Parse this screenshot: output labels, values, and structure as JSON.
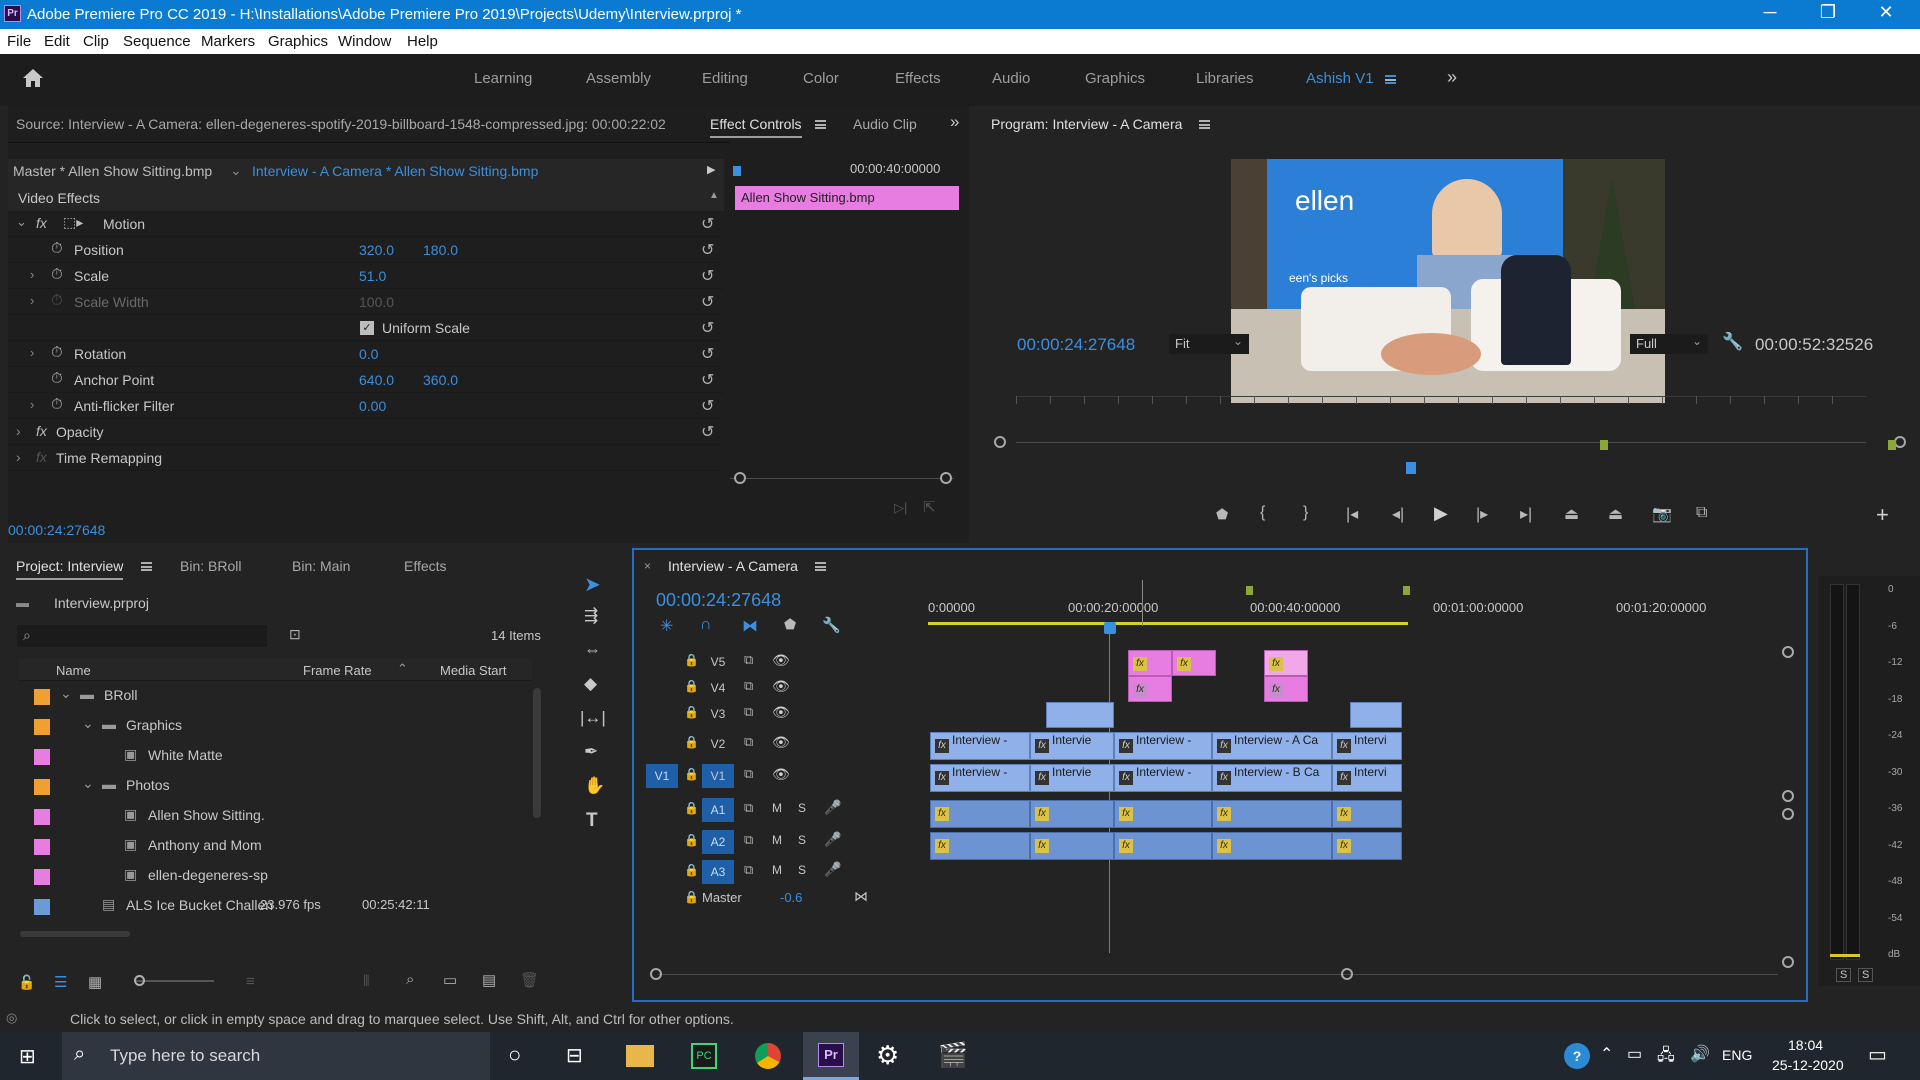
{
  "window": {
    "title": "Adobe Premiere Pro CC 2019 - H:\\Installations\\Adobe Premiere Pro 2019\\Projects\\Udemy\\Interview.prproj *",
    "app_icon": "Pr",
    "controls": [
      "─",
      "❐",
      "✕"
    ]
  },
  "menu": [
    "File",
    "Edit",
    "Clip",
    "Sequence",
    "Markers",
    "Graphics",
    "Window",
    "Help"
  ],
  "workspaces": [
    "Learning",
    "Assembly",
    "Editing",
    "Color",
    "Effects",
    "Audio",
    "Graphics",
    "Libraries"
  ],
  "active_workspace": "Ashish V1",
  "source_panel": {
    "source_tab": "Source: Interview - A Camera: ellen-degeneres-spotify-2019-billboard-1548-compressed.jpg: 00:00:22:02",
    "effect_controls_tab": "Effect Controls",
    "audio_clip_tab": "Audio Clip",
    "master_label": "Master * Allen Show Sitting.bmp",
    "clip_label": "Interview - A Camera * Allen Show Sitting.bmp",
    "mini_time": "00:00:40:00000",
    "mini_clip": "Allen Show Sitting.bmp",
    "video_effects": "Video Effects",
    "motion": "Motion",
    "position_label": "Position",
    "position_x": "320.0",
    "position_y": "180.0",
    "scale_label": "Scale",
    "scale_val": "51.0",
    "scale_width_label": "Scale Width",
    "scale_width_val": "100.0",
    "uniform_scale": "Uniform Scale",
    "rotation_label": "Rotation",
    "rotation_val": "0.0",
    "anchor_label": "Anchor Point",
    "anchor_x": "640.0",
    "anchor_y": "360.0",
    "antiflicker_label": "Anti-flicker Filter",
    "antiflicker_val": "0.00",
    "opacity": "Opacity",
    "time_remap": "Time Remapping",
    "timecode": "00:00:24:27648"
  },
  "program": {
    "title": "Program: Interview - A Camera",
    "timecode": "00:00:24:27648",
    "fit": "Fit",
    "full": "Full",
    "duration": "00:00:52:32526",
    "ellen_logo": "ellen",
    "picks_text": "een's picks"
  },
  "project": {
    "tabs": [
      "Project: Interview",
      "Bin: BRoll",
      "Bin: Main",
      "Effects"
    ],
    "file": "Interview.prproj",
    "items_count": "14 Items",
    "col_name": "Name",
    "col_fps": "Frame Rate",
    "col_start": "Media Start",
    "rows": [
      {
        "name": "BRoll",
        "color": "#f0a030"
      },
      {
        "name": "Graphics",
        "color": "#f0a030"
      },
      {
        "name": "White Matte",
        "color": "#e77de0"
      },
      {
        "name": "Photos",
        "color": "#f0a030"
      },
      {
        "name": "Allen Show Sitting.",
        "color": "#e77de0"
      },
      {
        "name": "Anthony and Mom",
        "color": "#e77de0"
      },
      {
        "name": "ellen-degeneres-sp",
        "color": "#e77de0"
      },
      {
        "name": "ALS Ice Bucket Challen",
        "color": "#6a9ad8",
        "fps": "23.976 fps",
        "start": "00:25:42:11"
      }
    ]
  },
  "timeline": {
    "tab": "Interview - A Camera",
    "timecode": "00:00:24:27648",
    "ruler": [
      "0:00000",
      "00:00:20:00000",
      "00:00:40:00000",
      "00:01:00:00000",
      "00:01:20:00000"
    ],
    "video_tracks": [
      "V5",
      "V4",
      "V3",
      "V2",
      "V1"
    ],
    "audio_tracks": [
      "A1",
      "A2",
      "A3"
    ],
    "v1_source": "V1",
    "master_label": "Master",
    "master_val": "-0.6",
    "m": "M",
    "s": "S",
    "clips_v2": [
      "Interview -",
      "Intervie",
      "Interview -",
      "Interview - A Ca",
      "Intervi"
    ],
    "clips_v1": [
      "Interview -",
      "Intervie",
      "Interview -",
      "Interview - B Ca",
      "Intervi"
    ]
  },
  "meter_ticks": [
    "0",
    "-6",
    "-12",
    "-18",
    "-24",
    "-30",
    "-36",
    "-42",
    "-48",
    "-54",
    "dB"
  ],
  "meter_buttons": [
    "S",
    "S"
  ],
  "status": "Click to select, or click in empty space and drag to marquee select. Use Shift, Alt, and Ctrl for other options.",
  "taskbar": {
    "search": "Type here to search",
    "lang": "ENG",
    "time": "18:04",
    "date": "25-12-2020"
  }
}
